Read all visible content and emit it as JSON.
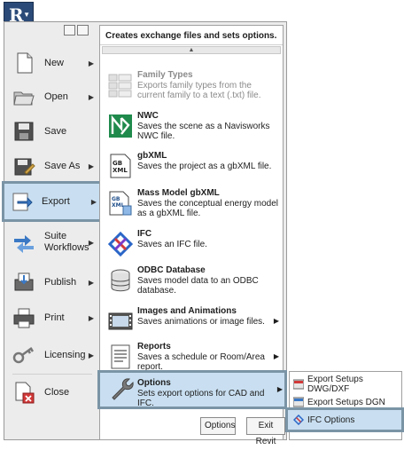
{
  "left_menu": [
    {
      "label": "New",
      "icon": "new-document-icon",
      "arrow": true
    },
    {
      "label": "Open",
      "icon": "open-folder-icon",
      "arrow": true
    },
    {
      "label": "Save",
      "icon": "save-disk-icon",
      "arrow": false
    },
    {
      "label": "Save As",
      "icon": "save-as-icon",
      "arrow": true
    },
    {
      "label": "Export",
      "icon": "export-icon",
      "arrow": true,
      "active": true
    },
    {
      "label": "Suite Workflows",
      "icon": "suite-workflows-icon",
      "arrow": true
    },
    {
      "label": "Publish",
      "icon": "publish-icon",
      "arrow": true
    },
    {
      "label": "Print",
      "icon": "printer-icon",
      "arrow": true
    },
    {
      "label": "Licensing",
      "icon": "key-icon",
      "arrow": true
    },
    {
      "label": "Close",
      "icon": "close-document-icon",
      "arrow": false
    }
  ],
  "panel": {
    "header": "Creates exchange files and sets options.",
    "items": [
      {
        "title": "Family Types",
        "desc": "Exports family types from the current family to a text (.txt) file.",
        "icon": "family-types-icon",
        "dim": true
      },
      {
        "title": "NWC",
        "desc": "Saves the scene as a Navisworks NWC file.",
        "icon": "navisworks-icon"
      },
      {
        "title": "gbXML",
        "desc": "Saves the project as a gbXML file.",
        "icon": "gbxml-icon"
      },
      {
        "title": "Mass Model gbXML",
        "desc": "Saves the conceptual energy model as a gbXML file.",
        "icon": "mass-model-gbxml-icon"
      },
      {
        "title": "IFC",
        "desc": "Saves an IFC file.",
        "icon": "ifc-icon"
      },
      {
        "title": "ODBC Database",
        "desc": "Saves model data to an ODBC database.",
        "icon": "database-icon"
      },
      {
        "title": "Images and Animations",
        "desc": "Saves animations or image files.",
        "icon": "film-icon",
        "arrow": true
      },
      {
        "title": "Reports",
        "desc": "Saves a schedule or Room/Area report.",
        "icon": "report-icon",
        "arrow": true
      },
      {
        "title": "Options",
        "desc": "Sets export options for CAD and IFC.",
        "icon": "wrench-icon",
        "arrow": true,
        "active": true
      }
    ],
    "options_button": "Options",
    "exit_button": "Exit Revit"
  },
  "submenu": {
    "items": [
      {
        "label": "Export Setups DWG/DXF",
        "icon": "dwg-setup-icon"
      },
      {
        "label": "Export Setups DGN",
        "icon": "dgn-setup-icon"
      },
      {
        "label": "IFC Options",
        "icon": "ifc-options-icon",
        "active": true
      }
    ]
  },
  "colors": {
    "highlight_fill": "#c9dff1",
    "highlight_border": "#7a94a6",
    "app_button": "#2b4a78"
  }
}
